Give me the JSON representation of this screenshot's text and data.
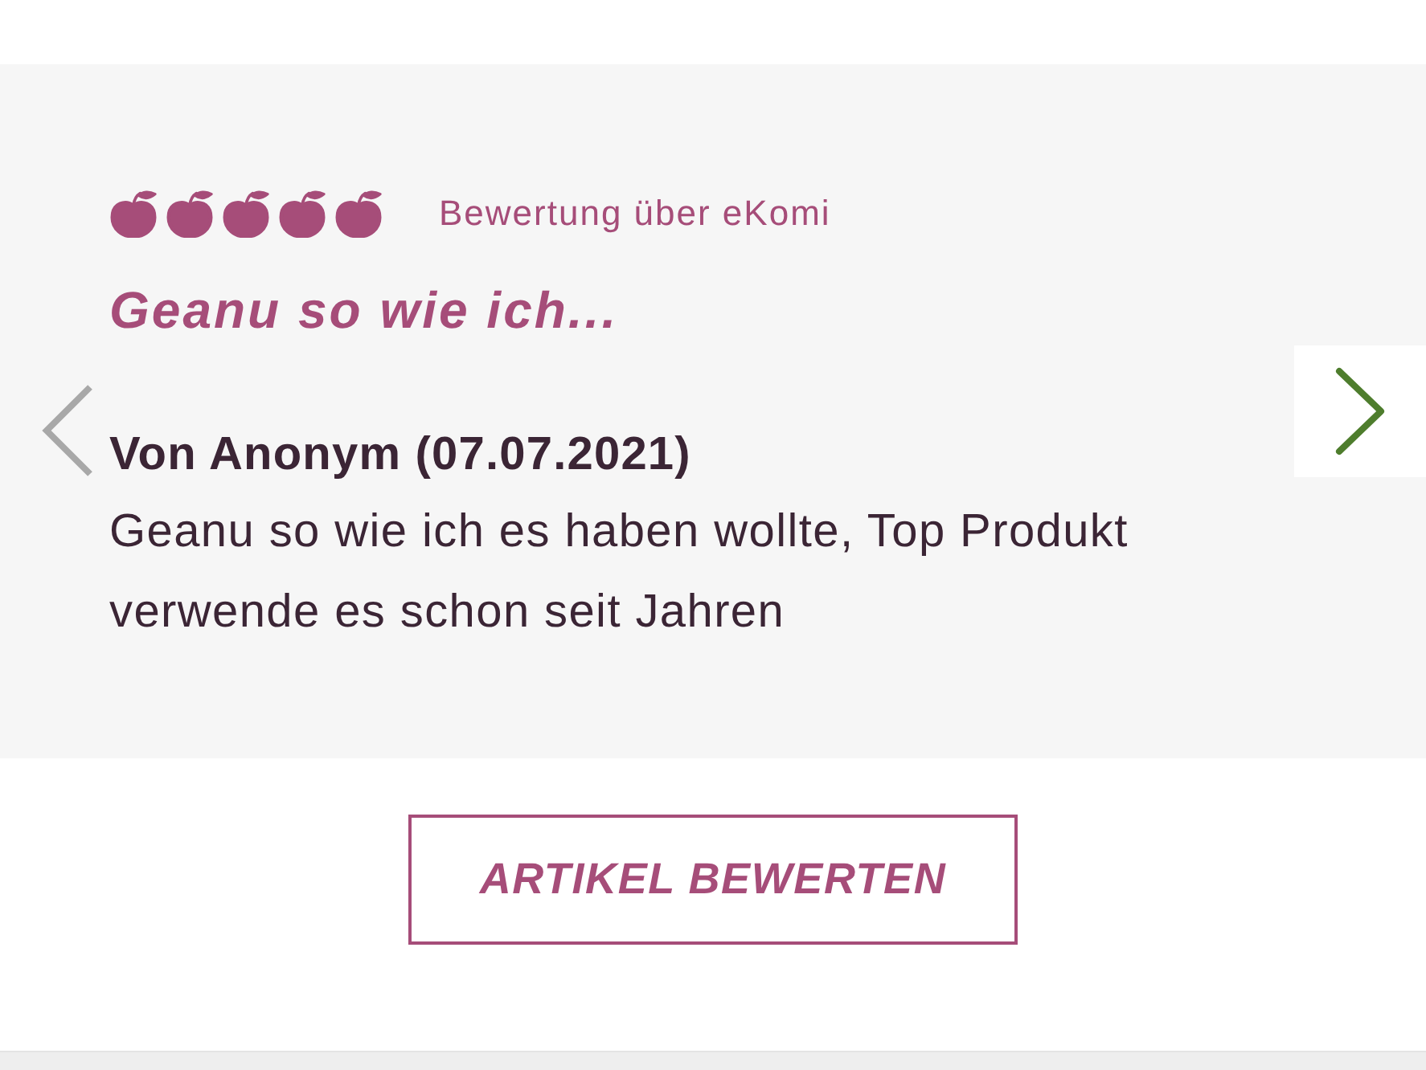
{
  "rating": {
    "stars": 5,
    "source": "Bewertung über eKomi"
  },
  "review": {
    "title": "Geanu so wie ich...",
    "author": "Von Anonym (07.07.2021)",
    "text": "Geanu so wie ich es haben wollte, Top Produkt verwende es schon seit Jahren"
  },
  "button": {
    "label": "ARTIKEL BEWERTEN"
  }
}
